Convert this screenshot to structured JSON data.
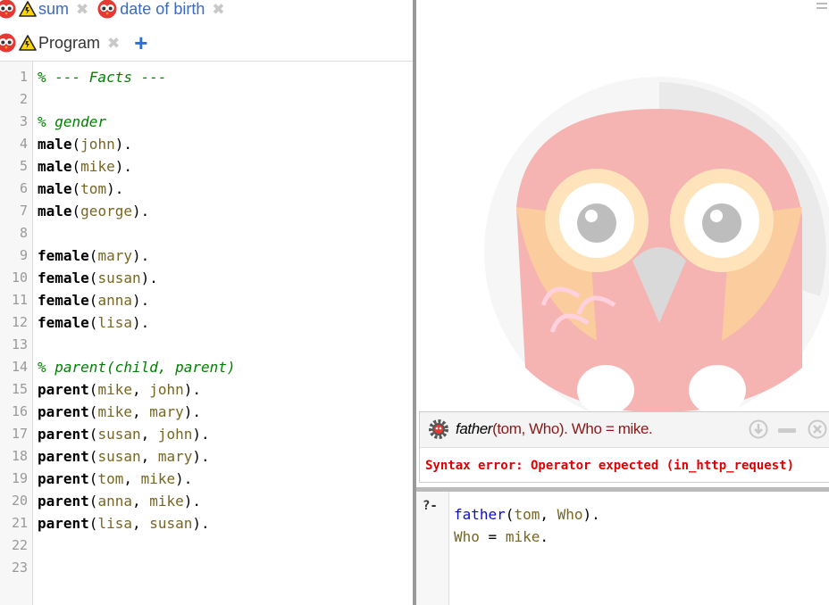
{
  "tabs_row1": [
    {
      "label": "sum"
    },
    {
      "label": "date of birth"
    }
  ],
  "tabs_row2": [
    {
      "label": "Program"
    }
  ],
  "add_tab_label": "+",
  "close_glyph": "✖",
  "program_lines": [
    {
      "n": "1",
      "tokens": [
        {
          "t": "% --- Facts ---",
          "c": "comment"
        }
      ]
    },
    {
      "n": "2",
      "tokens": []
    },
    {
      "n": "3",
      "tokens": [
        {
          "t": "% gender",
          "c": "comment"
        }
      ]
    },
    {
      "n": "4",
      "tokens": [
        {
          "t": "male",
          "c": "pred"
        },
        {
          "t": "(",
          "c": "punct"
        },
        {
          "t": "john",
          "c": "atom"
        },
        {
          "t": ").",
          "c": "punct"
        }
      ]
    },
    {
      "n": "5",
      "tokens": [
        {
          "t": "male",
          "c": "pred"
        },
        {
          "t": "(",
          "c": "punct"
        },
        {
          "t": "mike",
          "c": "atom"
        },
        {
          "t": ").",
          "c": "punct"
        }
      ]
    },
    {
      "n": "6",
      "tokens": [
        {
          "t": "male",
          "c": "pred"
        },
        {
          "t": "(",
          "c": "punct"
        },
        {
          "t": "tom",
          "c": "atom"
        },
        {
          "t": ").",
          "c": "punct"
        }
      ]
    },
    {
      "n": "7",
      "tokens": [
        {
          "t": "male",
          "c": "pred"
        },
        {
          "t": "(",
          "c": "punct"
        },
        {
          "t": "george",
          "c": "atom"
        },
        {
          "t": ").",
          "c": "punct"
        }
      ]
    },
    {
      "n": "8",
      "tokens": []
    },
    {
      "n": "9",
      "tokens": [
        {
          "t": "female",
          "c": "pred"
        },
        {
          "t": "(",
          "c": "punct"
        },
        {
          "t": "mary",
          "c": "atom"
        },
        {
          "t": ").",
          "c": "punct"
        }
      ]
    },
    {
      "n": "10",
      "tokens": [
        {
          "t": "female",
          "c": "pred"
        },
        {
          "t": "(",
          "c": "punct"
        },
        {
          "t": "susan",
          "c": "atom"
        },
        {
          "t": ").",
          "c": "punct"
        }
      ]
    },
    {
      "n": "11",
      "tokens": [
        {
          "t": "female",
          "c": "pred"
        },
        {
          "t": "(",
          "c": "punct"
        },
        {
          "t": "anna",
          "c": "atom"
        },
        {
          "t": ").",
          "c": "punct"
        }
      ]
    },
    {
      "n": "12",
      "tokens": [
        {
          "t": "female",
          "c": "pred"
        },
        {
          "t": "(",
          "c": "punct"
        },
        {
          "t": "lisa",
          "c": "atom"
        },
        {
          "t": ").",
          "c": "punct"
        }
      ]
    },
    {
      "n": "13",
      "tokens": []
    },
    {
      "n": "14",
      "tokens": [
        {
          "t": "% parent(child, parent)",
          "c": "comment"
        }
      ]
    },
    {
      "n": "15",
      "tokens": [
        {
          "t": "parent",
          "c": "pred"
        },
        {
          "t": "(",
          "c": "punct"
        },
        {
          "t": "mike",
          "c": "atom"
        },
        {
          "t": ", ",
          "c": "punct"
        },
        {
          "t": "john",
          "c": "atom"
        },
        {
          "t": ").",
          "c": "punct"
        }
      ]
    },
    {
      "n": "16",
      "tokens": [
        {
          "t": "parent",
          "c": "pred"
        },
        {
          "t": "(",
          "c": "punct"
        },
        {
          "t": "mike",
          "c": "atom"
        },
        {
          "t": ", ",
          "c": "punct"
        },
        {
          "t": "mary",
          "c": "atom"
        },
        {
          "t": ").",
          "c": "punct"
        }
      ]
    },
    {
      "n": "17",
      "tokens": [
        {
          "t": "parent",
          "c": "pred"
        },
        {
          "t": "(",
          "c": "punct"
        },
        {
          "t": "susan",
          "c": "atom"
        },
        {
          "t": ", ",
          "c": "punct"
        },
        {
          "t": "john",
          "c": "atom"
        },
        {
          "t": ").",
          "c": "punct"
        }
      ]
    },
    {
      "n": "18",
      "tokens": [
        {
          "t": "parent",
          "c": "pred"
        },
        {
          "t": "(",
          "c": "punct"
        },
        {
          "t": "susan",
          "c": "atom"
        },
        {
          "t": ", ",
          "c": "punct"
        },
        {
          "t": "mary",
          "c": "atom"
        },
        {
          "t": ").",
          "c": "punct"
        }
      ]
    },
    {
      "n": "19",
      "tokens": [
        {
          "t": "parent",
          "c": "pred"
        },
        {
          "t": "(",
          "c": "punct"
        },
        {
          "t": "tom",
          "c": "atom"
        },
        {
          "t": ", ",
          "c": "punct"
        },
        {
          "t": "mike",
          "c": "atom"
        },
        {
          "t": ").",
          "c": "punct"
        }
      ]
    },
    {
      "n": "20",
      "tokens": [
        {
          "t": "parent",
          "c": "pred"
        },
        {
          "t": "(",
          "c": "punct"
        },
        {
          "t": "anna",
          "c": "atom"
        },
        {
          "t": ", ",
          "c": "punct"
        },
        {
          "t": "mike",
          "c": "atom"
        },
        {
          "t": ").",
          "c": "punct"
        }
      ]
    },
    {
      "n": "21",
      "tokens": [
        {
          "t": "parent",
          "c": "pred"
        },
        {
          "t": "(",
          "c": "punct"
        },
        {
          "t": "lisa",
          "c": "atom"
        },
        {
          "t": ", ",
          "c": "punct"
        },
        {
          "t": "susan",
          "c": "atom"
        },
        {
          "t": ").",
          "c": "punct"
        }
      ]
    },
    {
      "n": "22",
      "tokens": []
    },
    {
      "n": "23",
      "tokens": []
    }
  ],
  "query_result": {
    "query_functor": "father",
    "query_rest": "(tom, Who). Who = mike.",
    "error_message": "Syntax error: Operator expected (in_http_request)"
  },
  "query_editor": {
    "prompt": "?-",
    "lines": [
      {
        "tokens": [
          {
            "t": "father",
            "c": "qpred"
          },
          {
            "t": "(",
            "c": "qpunct"
          },
          {
            "t": "tom",
            "c": "qatom"
          },
          {
            "t": ", ",
            "c": "qpunct"
          },
          {
            "t": "Who",
            "c": "qvar"
          },
          {
            "t": ").",
            "c": "qpunct"
          }
        ]
      },
      {
        "tokens": [
          {
            "t": "Who",
            "c": "qvar"
          },
          {
            "t": " = ",
            "c": "qpunct"
          },
          {
            "t": "mike",
            "c": "qatom"
          },
          {
            "t": ".",
            "c": "qpunct"
          }
        ]
      }
    ]
  },
  "icons": {
    "tab_owl": "swish-owl-icon",
    "tab_warning": "warning-icon",
    "query_gear": "gear-icon",
    "down": "download-icon",
    "minimize": "minimize-icon",
    "close": "close-icon",
    "menu": "menu-icon"
  },
  "colors": {
    "comment": "#008000",
    "atom": "#776622",
    "error": "#e00000",
    "link_tab": "#3a6bbf",
    "add_tab": "#2e6fd6"
  }
}
